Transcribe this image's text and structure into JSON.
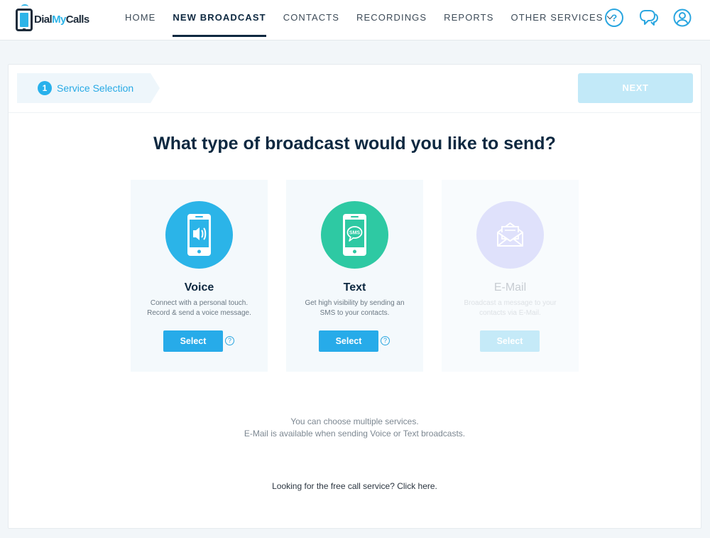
{
  "brand": {
    "logo_text_1": "Dial",
    "logo_text_2": "My",
    "logo_text_3": "Calls",
    "accent_color": "#28abe9"
  },
  "nav": {
    "items": [
      {
        "label": "HOME"
      },
      {
        "label": "NEW BROADCAST",
        "active": true
      },
      {
        "label": "CONTACTS"
      },
      {
        "label": "RECORDINGS"
      },
      {
        "label": "REPORTS"
      },
      {
        "label": "OTHER SERVICES"
      }
    ],
    "icons": [
      "help-icon",
      "chat-icon",
      "user-icon"
    ],
    "help_glyph": "?"
  },
  "wizard": {
    "step_number": "1",
    "step_label": "Service Selection",
    "next_label": "NEXT"
  },
  "main": {
    "headline": "What type of broadcast would you like to send?",
    "services": [
      {
        "title": "Voice",
        "desc_1": "Connect with a personal touch.",
        "desc_2": "Record & send a voice message.",
        "button": "Select",
        "icon": "phone-speaker-icon",
        "color": "#2bb4e8"
      },
      {
        "title": "Text",
        "desc_1": "Get high visibility by sending an",
        "desc_2": "SMS to your contacts.",
        "button": "Select",
        "icon": "phone-sms-icon",
        "sms_badge": "SMS",
        "color": "#2ec9a3"
      },
      {
        "title": "E-Mail",
        "desc_1": "Broadcast a message to your",
        "desc_2": "contacts via E-Mail.",
        "button": "Select",
        "icon": "envelope-icon",
        "disabled": true,
        "color": "#dfe1fb"
      }
    ],
    "info_glyph": "?",
    "note_1": "You can choose multiple services.",
    "note_2": "E-Mail is available when sending Voice or Text broadcasts.",
    "free_call_link": "Looking for the free call service? Click here."
  }
}
